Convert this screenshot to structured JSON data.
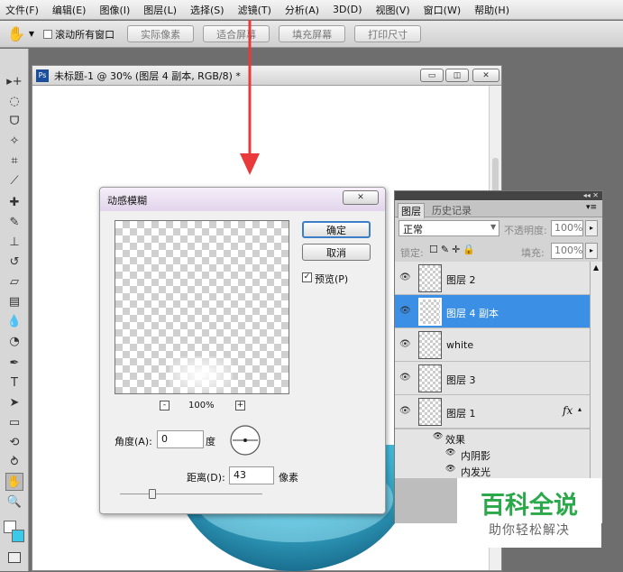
{
  "menu": [
    "文件(F)",
    "编辑(E)",
    "图像(I)",
    "图层(L)",
    "选择(S)",
    "滤镜(T)",
    "分析(A)",
    "3D(D)",
    "视图(V)",
    "窗口(W)",
    "帮助(H)"
  ],
  "options": {
    "scroll_all_label": "滚动所有窗口",
    "buttons": [
      "实际像素",
      "适合屏幕",
      "填充屏幕",
      "打印尺寸"
    ]
  },
  "document": {
    "title": "未标题-1 @ 30% (图层 4 副本, RGB/8) *"
  },
  "dialog": {
    "title": "动感模糊",
    "ok": "确定",
    "cancel": "取消",
    "preview_label": "预览(P)",
    "zoom": "100%",
    "zoom_out": "-",
    "zoom_in": "+",
    "angle_label": "角度(A):",
    "angle_value": "0",
    "angle_unit": "度",
    "distance_label": "距离(D):",
    "distance_value": "43",
    "distance_unit": "像素"
  },
  "layers_panel": {
    "tabs": [
      "图层",
      "历史记录"
    ],
    "blend_mode": "正常",
    "opacity_label": "不透明度:",
    "opacity": "100%",
    "lock_label": "锁定:",
    "fill_label": "填充:",
    "fill": "100%",
    "layers": [
      {
        "name": "图层 2"
      },
      {
        "name": "图层 4 副本"
      },
      {
        "name": "white"
      },
      {
        "name": "图层 3"
      },
      {
        "name": "图层 1"
      }
    ],
    "fx": "fx",
    "effects_label": "效果",
    "effects": [
      "内阴影",
      "内发光"
    ]
  },
  "watermark": {
    "title": "百科全说",
    "subtitle": "助你轻松解决"
  },
  "colors": {
    "accent": "#3b8fe5",
    "arrow": "#e83a3a",
    "watermark": "#2aa84a"
  }
}
